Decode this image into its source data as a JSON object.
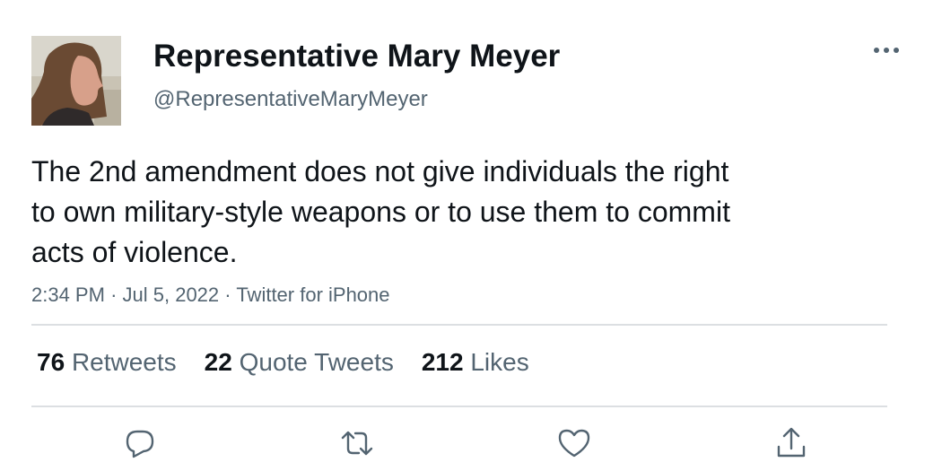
{
  "tweet": {
    "author": {
      "display_name": "Representative Mary Meyer",
      "handle": "@RepresentativeMaryMeyer"
    },
    "text_lines": [
      "The 2nd amendment does not give individuals the right",
      "to own military-style weapons or to use them to commit",
      "acts of violence."
    ],
    "time": "2:34 PM",
    "date": "Jul 5, 2022",
    "source": "Twitter for iPhone",
    "separator": "·"
  },
  "stats": {
    "retweets": {
      "count": "76",
      "label": "Retweets"
    },
    "quote_tweets": {
      "count": "22",
      "label": "Quote Tweets"
    },
    "likes": {
      "count": "212",
      "label": "Likes"
    }
  },
  "actions": {
    "reply": "reply-icon",
    "retweet": "retweet-icon",
    "like": "heart-icon",
    "share": "share-icon"
  },
  "colors": {
    "text_primary": "#0f1419",
    "text_secondary": "#536471",
    "divider": "#dcdfe2"
  }
}
